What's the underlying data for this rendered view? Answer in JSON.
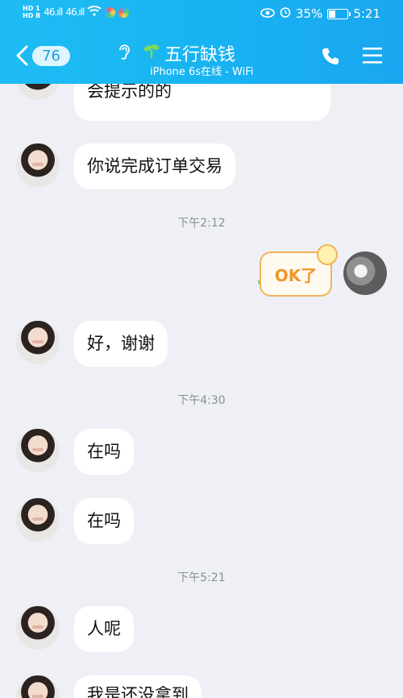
{
  "status_bar": {
    "hd1": "HD 1",
    "hd2": "HD B",
    "net1": "46.ıll",
    "net2": "46.ıll",
    "battery_text": "35%",
    "time": "5:21",
    "battery_level": 0.35
  },
  "header": {
    "back_count": "76",
    "title": "五行缺钱",
    "subtitle": "iPhone 6s在线 - WiFi"
  },
  "messages": [
    {
      "side": "left",
      "text": "点这里，说完成交易，会提示的的",
      "partial": true
    },
    {
      "side": "left",
      "text": "你说完成订单交易"
    },
    {
      "type": "time",
      "text": "下午2:12"
    },
    {
      "side": "right",
      "sticker": "OK了"
    },
    {
      "side": "left",
      "text": "好，谢谢"
    },
    {
      "type": "time",
      "text": "下午4:30"
    },
    {
      "side": "left",
      "text": "在吗"
    },
    {
      "side": "left",
      "text": "在吗"
    },
    {
      "type": "time",
      "text": "下午5:21"
    },
    {
      "side": "left",
      "text": "人呢"
    },
    {
      "side": "left",
      "text": "我是还没拿到"
    }
  ],
  "colors": {
    "header_bg": "#18b4f2",
    "chat_bg": "#eef0f5",
    "bubble_bg": "#ffffff"
  }
}
